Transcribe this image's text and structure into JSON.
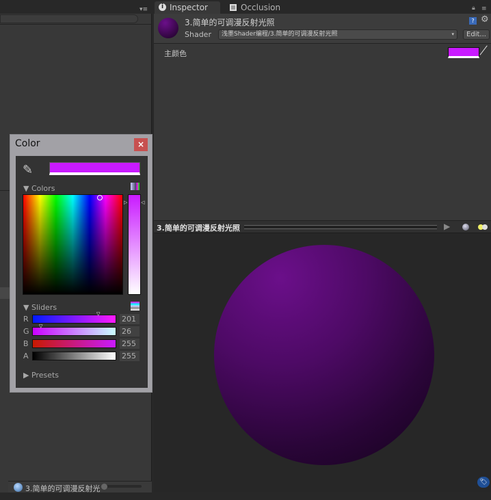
{
  "inspector": {
    "tabs": [
      {
        "label": "Inspector",
        "icon": "info-icon"
      },
      {
        "label": "Occlusion",
        "icon": "occlusion-icon"
      }
    ],
    "material_name": "3.简单的可调漫反射光照",
    "shader_label": "Shader",
    "shader_value": "浅墨Shader编程/3.简单的可调漫反射光照",
    "edit_label": "Edit...",
    "property_label": "主颜色",
    "property_color": "#c91aff"
  },
  "preview": {
    "title": "3.简单的可调漫反射光照",
    "sphere_color": "#4e0a66"
  },
  "left_panel": {
    "asset_label": "3.简单的可调漫反射光"
  },
  "color_picker": {
    "title": "Color",
    "current_color": "#c91aff",
    "colors_label": "Colors",
    "sliders_label": "Sliders",
    "presets_label": "Presets",
    "channels": [
      {
        "label": "R",
        "value": "201"
      },
      {
        "label": "G",
        "value": "26"
      },
      {
        "label": "B",
        "value": "255"
      },
      {
        "label": "A",
        "value": "255"
      }
    ]
  }
}
